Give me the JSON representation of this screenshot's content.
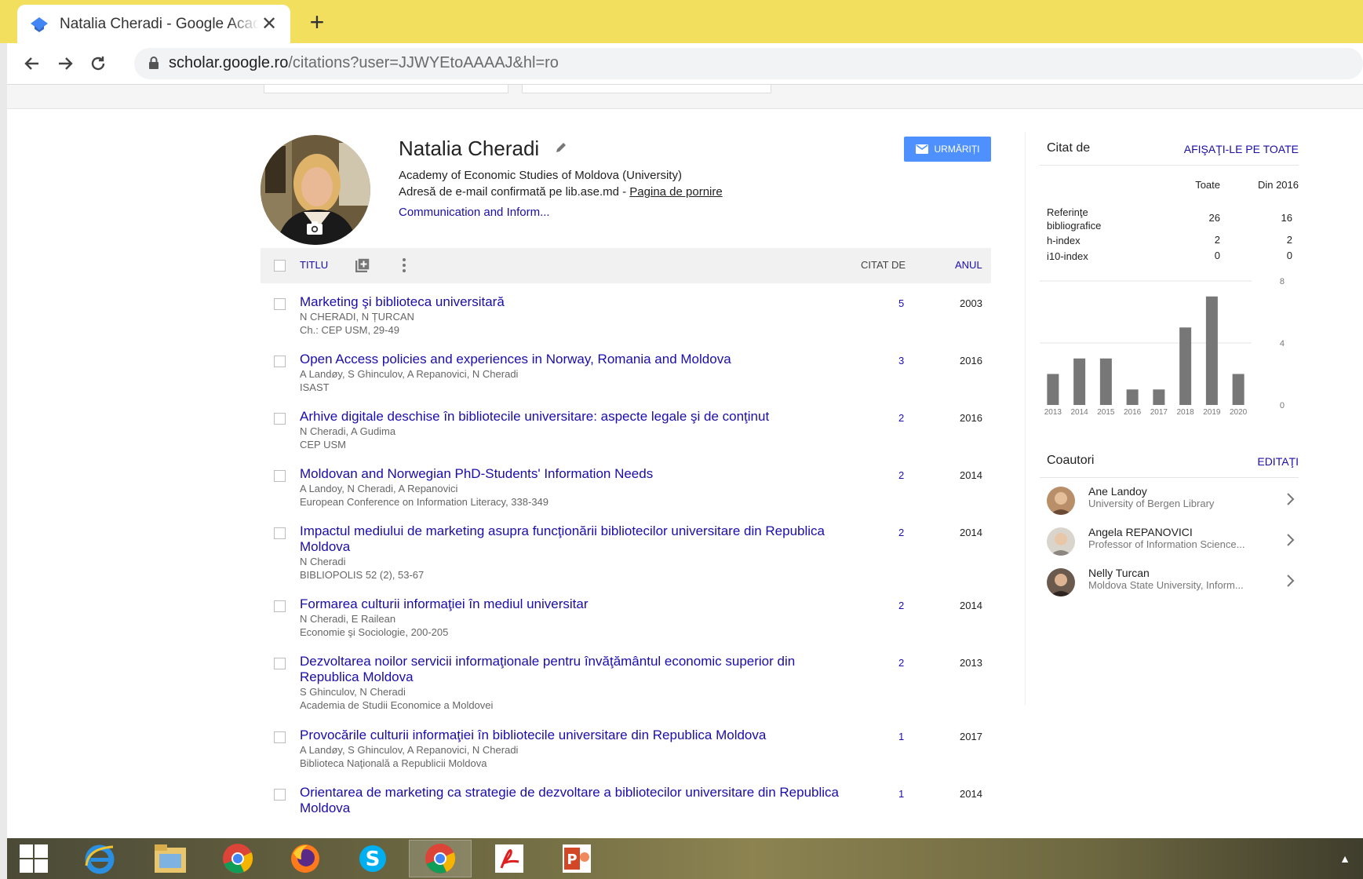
{
  "browser": {
    "tab_title": "Natalia Cheradi - Google Academic",
    "new_tab_symbol": "+",
    "close_symbol": "✕",
    "url_host": "scholar.google.ro",
    "url_path": "/citations?user=JJWYEtoAAAAJ&hl=ro"
  },
  "profile": {
    "name": "Natalia Cheradi",
    "affiliation": "Academy of Economic Studies of Moldova (University)",
    "email_text": "Adresă de e-mail confirmată pe lib.ase.md - ",
    "homepage_link": "Pagina de pornire",
    "interest": "Communication and Inform...",
    "follow_label": "URMĂRIȚI"
  },
  "list_header": {
    "title": "TITLU",
    "cited_by": "CITAT DE",
    "year": "ANUL"
  },
  "articles": [
    {
      "title": "Marketing şi biblioteca universitară",
      "authors": "N CHERADI, N ȚURCAN",
      "venue": "Ch.: CEP USM, 29-49",
      "cited": "5",
      "year": "2003"
    },
    {
      "title": "Open Access policies and experiences in Norway, Romania and Moldova",
      "authors": "A Landøy, S Ghinculov, A Repanovici, N Cheradi",
      "venue": "ISAST",
      "cited": "3",
      "year": "2016"
    },
    {
      "title": "Arhive digitale deschise în bibliotecile universitare: aspecte legale şi de conţinut",
      "authors": "N Cheradi, A Gudima",
      "venue": "CEP USM",
      "cited": "2",
      "year": "2016"
    },
    {
      "title": "Moldovan and Norwegian PhD-Students' Information Needs",
      "authors": "A Landoy, N Cheradi, A Repanovici",
      "venue": "European Conference on Information Literacy, 338-349",
      "cited": "2",
      "year": "2014"
    },
    {
      "title": "Impactul mediului de marketing asupra funcţionării bibliotecilor universitare din Republica Moldova",
      "authors": "N Cheradi",
      "venue": "BIBLIOPOLIS 52 (2), 53-67",
      "cited": "2",
      "year": "2014"
    },
    {
      "title": "Formarea culturii informaţiei în mediul universitar",
      "authors": "N Cheradi, E Railean",
      "venue": "Economie şi Sociologie, 200-205",
      "cited": "2",
      "year": "2014"
    },
    {
      "title": "Dezvoltarea noilor servicii informaţionale pentru învăţământul economic superior din Republica Moldova",
      "authors": "S Ghinculov, N Cheradi",
      "venue": "Academia de Studii Economice a Moldovei",
      "cited": "2",
      "year": "2013"
    },
    {
      "title": "Provocările culturii informaţiei în bibliotecile universitare din Republica Moldova",
      "authors": "A Landøy, S Ghinculov, A Repanovici, N Cheradi",
      "venue": "Biblioteca Naţională a Republicii Moldova",
      "cited": "1",
      "year": "2017"
    },
    {
      "title": "Orientarea de marketing ca strategie de dezvoltare a bibliotecilor universitare din Republica Moldova",
      "authors": "",
      "venue": "",
      "cited": "1",
      "year": "2014"
    }
  ],
  "cited_by": {
    "title": "Citat de",
    "show_all": "AFIŞAŢI-LE PE TOATE",
    "col_all": "Toate",
    "col_since": "Din 2016",
    "metrics": [
      {
        "label": "Referinţe bibliografice",
        "all": "26",
        "since": "16"
      },
      {
        "label": "h-index",
        "all": "2",
        "since": "2"
      },
      {
        "label": "i10-index",
        "all": "0",
        "since": "0"
      }
    ]
  },
  "chart_data": {
    "type": "bar",
    "categories": [
      "2013",
      "2014",
      "2015",
      "2016",
      "2017",
      "2018",
      "2019",
      "2020"
    ],
    "values": [
      2,
      3,
      3,
      1,
      1,
      5,
      7,
      2
    ],
    "ylim": [
      0,
      8
    ],
    "yticks": [
      "8",
      "4",
      "0"
    ],
    "bar_color": "#777777",
    "grid": true
  },
  "coauthors": {
    "title": "Coautori",
    "edit": "EDITAŢI",
    "items": [
      {
        "name": "Ane Landoy",
        "affiliation": "University of Bergen Library"
      },
      {
        "name": "Angela REPANOVICI",
        "affiliation": "Professor of Information Science..."
      },
      {
        "name": "Nelly Turcan",
        "affiliation": "Moldova State University, Inform..."
      }
    ]
  },
  "colors": {
    "tabbar": "#f1df5d",
    "link": "#1a0dab",
    "button": "#4d90fe"
  },
  "taskbar": {
    "items": [
      "windows-start",
      "internet-explorer",
      "file-explorer",
      "chrome",
      "firefox",
      "skype",
      "chrome",
      "acrobat-reader",
      "powerpoint"
    ],
    "tray_symbol": "▲"
  }
}
